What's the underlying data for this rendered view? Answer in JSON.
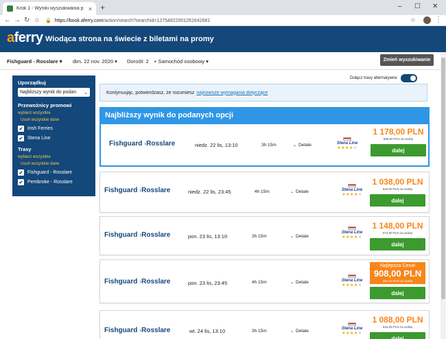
{
  "browser": {
    "tab_title": "Krok 1 - Wyniki wyszukiwania p",
    "url_host": "https://book.aferry.com",
    "url_path": "/action/search?searchid=127548220012616426​81"
  },
  "header": {
    "logo_a": "a",
    "logo_rest": "ferry",
    "tagline": "Wiodąca strona na świecie z biletami na promy"
  },
  "summary": {
    "route": "Fishguard - Rosslare",
    "date": "dim. 22 nov. 2020",
    "adults": "Dorośli: 2",
    "vehicle": "+ Samochód osobowy",
    "modify_label": "Zmień wyszukiwanie"
  },
  "sidebar": {
    "sort_title": "Uporządkuj",
    "sort_value": "Najbliższy wynik do podan",
    "operators_title": "Przewoźnicy promowi",
    "select_all": "wybierz wszystkie",
    "clear_all": "Usuń wszystkie dane",
    "operators": [
      "Irish Ferries",
      "Stena Line"
    ],
    "routes_title": "Trasy",
    "routes_select_all": "wybierz wszystkie",
    "routes_clear_all": "Usuń wszystkie dane",
    "routes": [
      "Fishguard - Rosslare",
      "Pembroke - Rosslare"
    ]
  },
  "toggle": {
    "label": "Dołącz trasy alternatywne",
    "on": true
  },
  "notice": {
    "text": "Kontynuując, potwierdzasz, że rozumiesz",
    "link": "najnowsze wymagania dotyczące"
  },
  "best_header": "Najbliższy wynik do podanych opcji",
  "results": [
    {
      "from": "Fishguard",
      "to": "Rosslare",
      "datetime": "niedz. 22 lis, 13:10",
      "duration": "3h 15m",
      "details": "Detale",
      "operator": "Stena Line",
      "stars": 4,
      "price": "1 178,00 PLN",
      "per_person": "589,00 PLN za osobę",
      "button": "dalej",
      "badge": ""
    },
    {
      "from": "Fishguard",
      "to": "Rosslare",
      "datetime": "niedz. 22 lis, 23:45",
      "duration": "4h 15m",
      "details": "Detale",
      "operator": "Stena Line",
      "stars": 4,
      "price": "1 038,00 PLN",
      "per_person": "519,00 PLN za osobę",
      "button": "dalej",
      "badge": ""
    },
    {
      "from": "Fishguard",
      "to": "Rosslare",
      "datetime": "pon. 23 lis, 13:10",
      "duration": "3h 15m",
      "details": "Detale",
      "operator": "Stena Line",
      "stars": 4,
      "price": "1 148,00 PLN",
      "per_person": "574,00 PLN za osobę",
      "button": "dalej",
      "badge": ""
    },
    {
      "from": "Fishguard",
      "to": "Rosslare",
      "datetime": "pon. 23 lis, 23:45",
      "duration": "4h 15m",
      "details": "Detale",
      "operator": "Stena Line",
      "stars": 4,
      "price": "908,00 PLN",
      "per_person": "454,00 PLN za osobę",
      "button": "dalej",
      "badge": "Najlepsza Cena!"
    },
    {
      "from": "Fishguard",
      "to": "Rosslare",
      "datetime": "wt. 24 lis, 13:10",
      "duration": "3h 15m",
      "details": "Detale",
      "operator": "Stena Line",
      "stars": 4,
      "price": "1 088,00 PLN",
      "per_person": "544,00 PLN za osobę",
      "button": "dalej",
      "badge": ""
    }
  ]
}
